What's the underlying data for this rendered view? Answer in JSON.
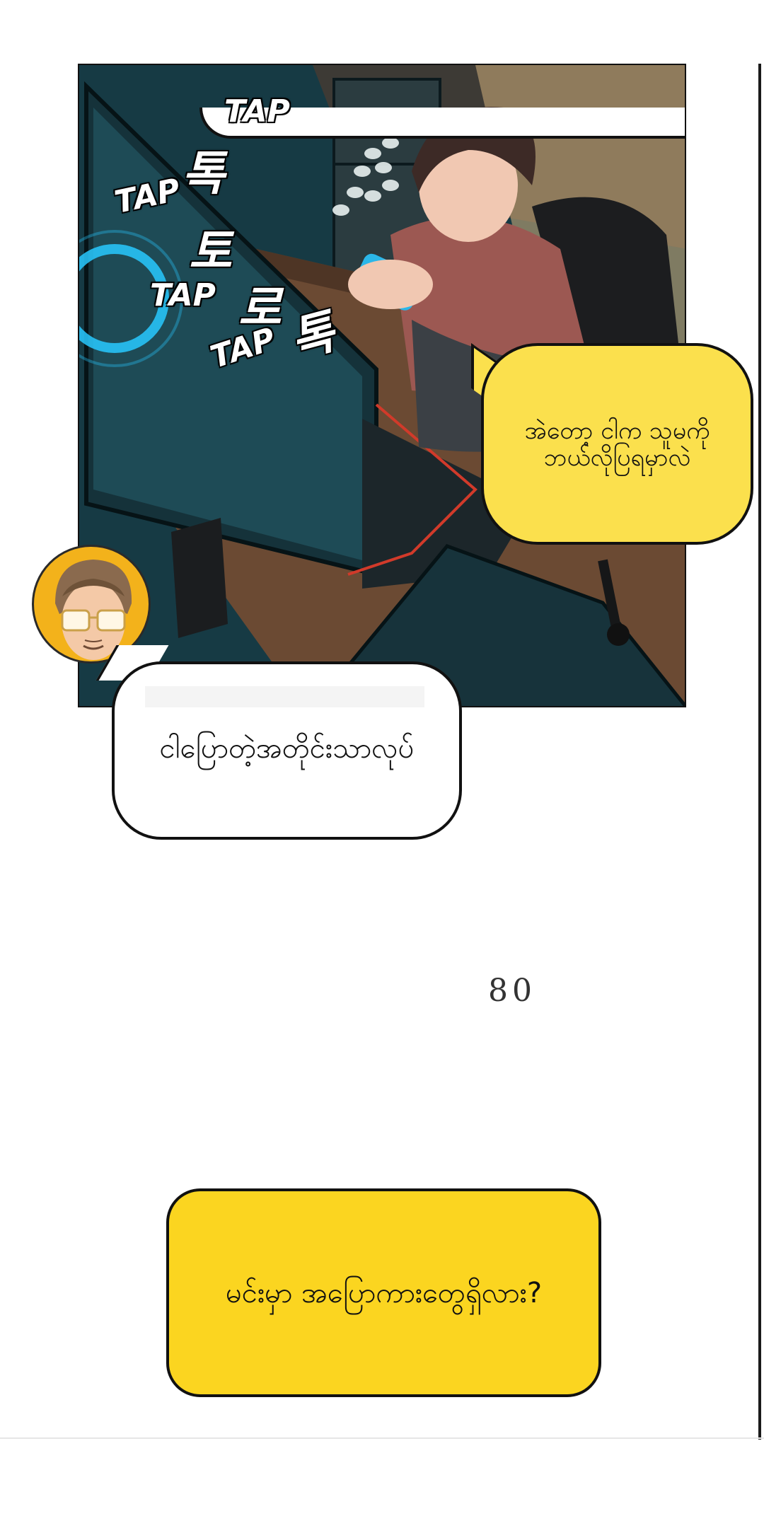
{
  "sfx": {
    "tap_1": "TAP",
    "tap_2": "TAP",
    "tap_3": "TAP",
    "tap_4": "TAP",
    "korean_1": "톡",
    "korean_2": "토",
    "korean_3": "로",
    "korean_4": "톡"
  },
  "bubbles": {
    "yellow_right_text": "အဲတော့ ငါက သူမကို ဘယ်လိုပြရမှာလဲ",
    "white_text": "ငါပြောတဲ့အတိုင်းသာလုပ်",
    "bottom_text": "မင်းမှာ အပြောကားတွေရှိလား?"
  },
  "page": {
    "number": "80"
  },
  "colors": {
    "bubble_yellow": "#fbe04d",
    "bubble_bottom_yellow": "#fbd520",
    "avatar_ring": "#f3b21b",
    "monitor_glow": "#28c9ff"
  },
  "icons": {
    "avatar": "character-avatar-icon"
  }
}
